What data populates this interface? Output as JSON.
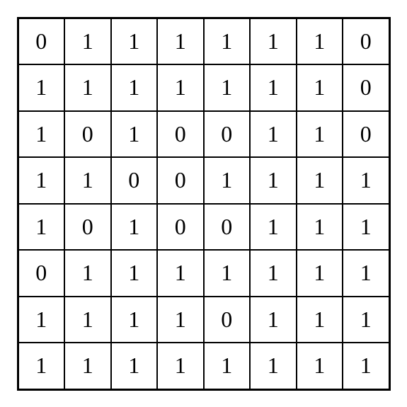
{
  "grid": {
    "rows": 8,
    "cols": 8,
    "cells": [
      [
        0,
        1,
        1,
        1,
        1,
        1,
        1,
        0
      ],
      [
        1,
        1,
        1,
        1,
        1,
        1,
        1,
        0
      ],
      [
        1,
        0,
        1,
        0,
        0,
        1,
        1,
        0
      ],
      [
        1,
        1,
        0,
        0,
        1,
        1,
        1,
        1
      ],
      [
        1,
        0,
        1,
        0,
        0,
        1,
        1,
        1
      ],
      [
        0,
        1,
        1,
        1,
        1,
        1,
        1,
        1
      ],
      [
        1,
        1,
        1,
        1,
        0,
        1,
        1,
        1
      ],
      [
        1,
        1,
        1,
        1,
        1,
        1,
        1,
        1
      ]
    ]
  }
}
